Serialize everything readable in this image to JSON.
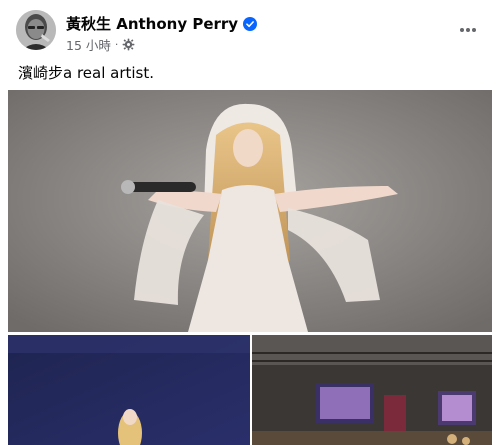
{
  "post": {
    "author": "黃秋生 Anthony Perry",
    "time": "15 小時",
    "separator": "·",
    "text": "濱崎步a real artist."
  },
  "icons": {
    "avatar": "profile-photo",
    "verified": "verified-badge-icon",
    "privacy": "gear-icon",
    "more": "more-horizontal-icon"
  },
  "colors": {
    "verified": "#0866ff",
    "meta_text": "#65676b",
    "card_bg": "#ffffff"
  }
}
